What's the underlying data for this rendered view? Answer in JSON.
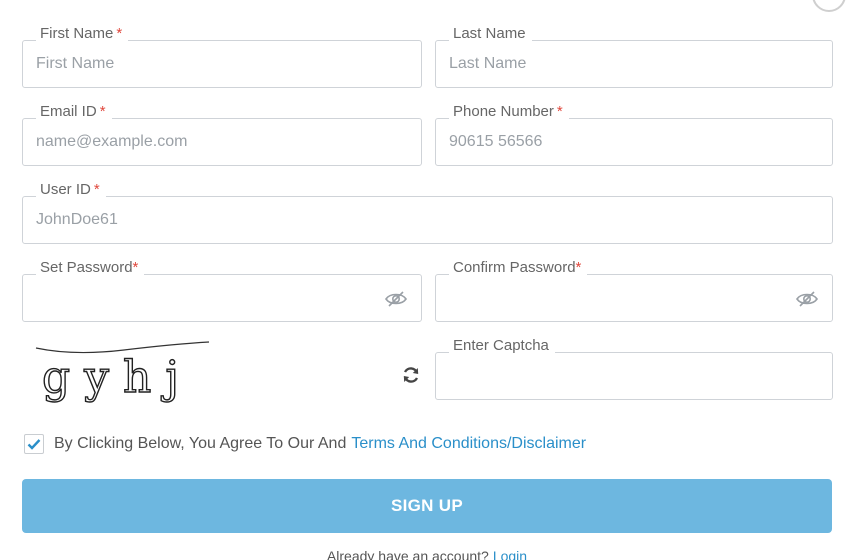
{
  "form": {
    "first_name": {
      "label": "First Name",
      "required_mark": "*",
      "placeholder": "First Name"
    },
    "last_name": {
      "label": "Last Name",
      "placeholder": "Last Name"
    },
    "email": {
      "label": "Email ID",
      "required_mark": "*",
      "placeholder": "name@example.com"
    },
    "phone": {
      "label": "Phone Number",
      "required_mark": "*",
      "placeholder": "90615 56566"
    },
    "user_id": {
      "label": "User ID",
      "required_mark": "*",
      "placeholder": "JohnDoe61"
    },
    "set_password": {
      "label": "Set Password",
      "required_mark": "*",
      "icon": "eye-slash-icon"
    },
    "confirm_password": {
      "label": "Confirm Password",
      "required_mark": "*",
      "icon": "eye-slash-icon"
    },
    "captcha": {
      "text": "gyhj",
      "refresh_icon": "refresh-icon",
      "input_label": "Enter Captcha"
    },
    "agreement": {
      "checked": true,
      "text": "By Clicking Below, You Agree To Our And",
      "link": "Terms And Conditions/Disclaimer"
    },
    "submit_label": "SIGN UP"
  },
  "footer": {
    "text": "Already have an account?",
    "link": "Login"
  },
  "colors": {
    "primary": "#6db7e0",
    "link": "#2a8fc9",
    "required": "#e0473c",
    "border": "#cfd3d8"
  }
}
